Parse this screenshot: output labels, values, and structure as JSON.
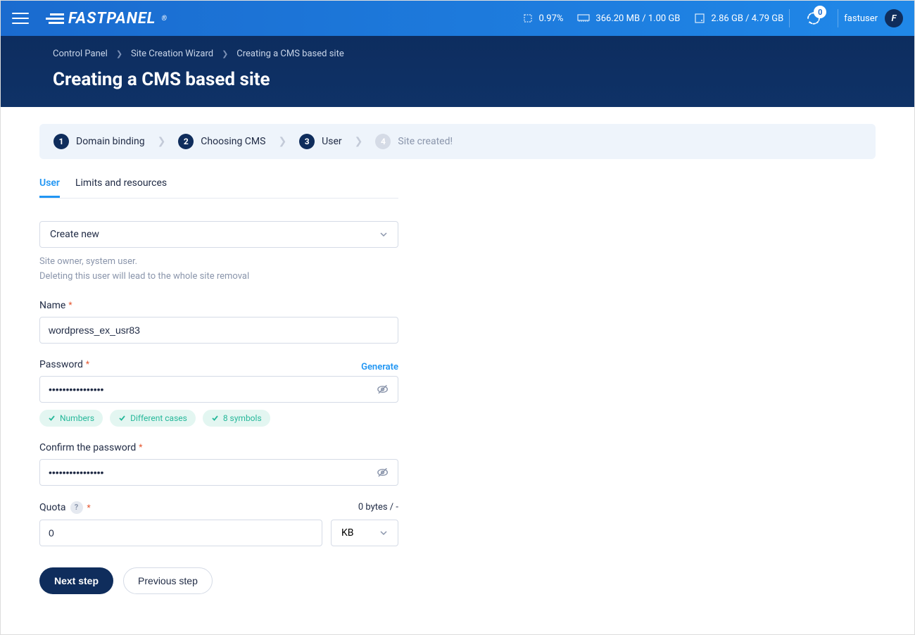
{
  "header": {
    "logo": "FASTPANEL",
    "cpu": "0.97%",
    "ram": "366.20 MB / 1.00 GB",
    "disk": "2.86 GB / 4.79 GB",
    "notif_count": "0",
    "username": "fastuser",
    "avatar_letter": "F"
  },
  "breadcrumbs": {
    "items": [
      "Control Panel",
      "Site Creation Wizard",
      "Creating a CMS based site"
    ]
  },
  "page_title": "Creating a CMS based site",
  "steps": {
    "items": [
      {
        "num": "1",
        "label": "Domain binding",
        "active": true
      },
      {
        "num": "2",
        "label": "Choosing CMS",
        "active": true
      },
      {
        "num": "3",
        "label": "User",
        "active": true
      },
      {
        "num": "4",
        "label": "Site created!",
        "active": false
      }
    ]
  },
  "tabs": {
    "items": [
      "User",
      "Limits and resources"
    ],
    "active": 0
  },
  "form": {
    "owner_select": "Create new",
    "owner_help1": "Site owner, system user.",
    "owner_help2": "Deleting this user will lead to the whole site removal",
    "name_label": "Name",
    "name_value": "wordpress_ex_usr83",
    "password_label": "Password",
    "generate": "Generate",
    "password_value": "••••••••••••••••",
    "chips": [
      "Numbers",
      "Different cases",
      "8 symbols"
    ],
    "confirm_label": "Confirm the password",
    "confirm_value": "••••••••••••••••",
    "quota_label": "Quota",
    "quota_info": "0 bytes / -",
    "quota_value": "0",
    "quota_unit": "KB"
  },
  "actions": {
    "next": "Next step",
    "prev": "Previous step"
  }
}
